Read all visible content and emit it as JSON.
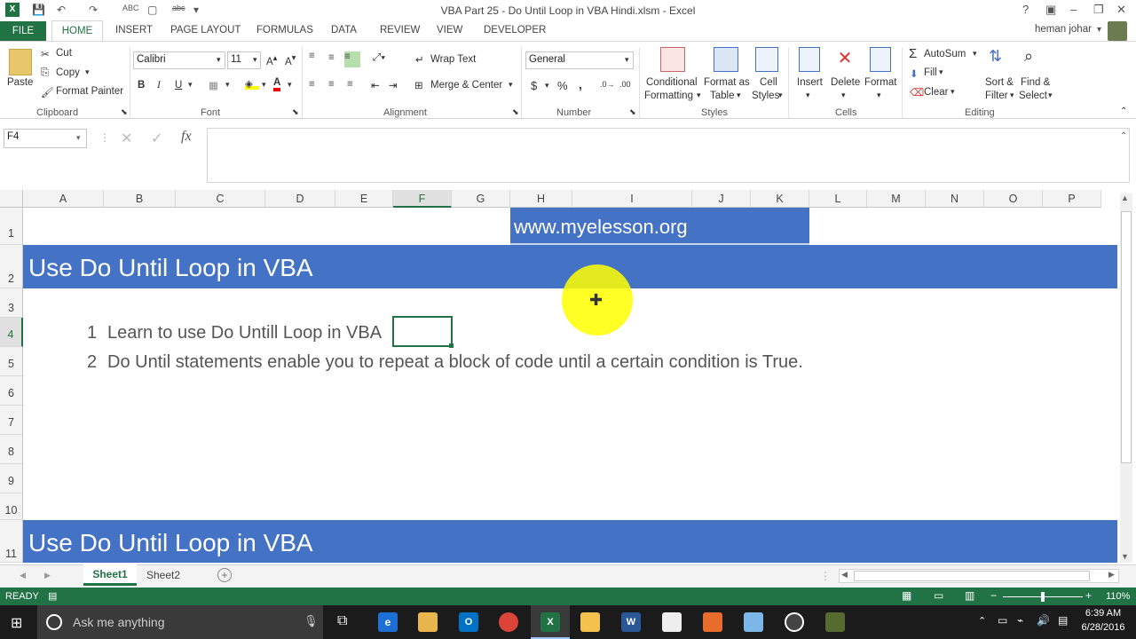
{
  "window": {
    "title": "VBA Part 25 -  Do Until Loop in VBA Hindi.xlsm - Excel",
    "user": "heman johar"
  },
  "tabs": [
    "FILE",
    "HOME",
    "INSERT",
    "PAGE LAYOUT",
    "FORMULAS",
    "DATA",
    "REVIEW",
    "VIEW",
    "DEVELOPER"
  ],
  "ribbon": {
    "clipboard": {
      "paste": "Paste",
      "cut": "Cut",
      "copy": "Copy",
      "format_painter": "Format Painter",
      "label": "Clipboard"
    },
    "font": {
      "name": "Calibri",
      "size": "11",
      "bold": "B",
      "italic": "I",
      "underline": "U",
      "label": "Font"
    },
    "alignment": {
      "wrap": "Wrap Text",
      "merge": "Merge & Center",
      "label": "Alignment"
    },
    "number": {
      "format": "General",
      "currency": "$",
      "percent": "%",
      "comma": ",",
      "label": "Number"
    },
    "styles": {
      "conditional": "Conditional",
      "formatting": "Formatting",
      "format_as": "Format as",
      "table": "Table",
      "cell": "Cell",
      "styles": "Styles",
      "label": "Styles"
    },
    "cells": {
      "insert": "Insert",
      "delete": "Delete",
      "format": "Format",
      "label": "Cells"
    },
    "editing": {
      "autosum": "AutoSum",
      "fill": "Fill",
      "clear": "Clear",
      "sort": "Sort &",
      "filter": "Filter",
      "find": "Find &",
      "select": "Select",
      "label": "Editing"
    }
  },
  "formula_bar": {
    "name_box": "F4",
    "fx": "fx",
    "content": ""
  },
  "columns": [
    "A",
    "B",
    "C",
    "D",
    "E",
    "F",
    "G",
    "H",
    "I",
    "J",
    "K",
    "L",
    "M",
    "N",
    "O",
    "P"
  ],
  "rows": [
    "1",
    "2",
    "3",
    "4",
    "5",
    "6",
    "7",
    "8",
    "9",
    "10",
    "11"
  ],
  "cells": {
    "h1": "www.myelesson.org",
    "row2": "Use Do Until Loop in VBA",
    "row4_num": "1",
    "row4_text": "Learn to use Do Untill Loop in VBA",
    "row5_num": "2",
    "row5_text": "Do Until statements enable you to repeat a block of code until a certain condition is True.",
    "row11": "Use Do Until Loop in VBA"
  },
  "sheets": [
    "Sheet1",
    "Sheet2"
  ],
  "status": {
    "mode": "READY",
    "zoom": "110%"
  },
  "taskbar": {
    "search": "Ask me anything",
    "time": "6:39 AM",
    "date": "6/28/2016"
  },
  "colors": {
    "excel_green": "#217346",
    "banner_blue": "#4472c4",
    "highlight": "#ffff00"
  }
}
